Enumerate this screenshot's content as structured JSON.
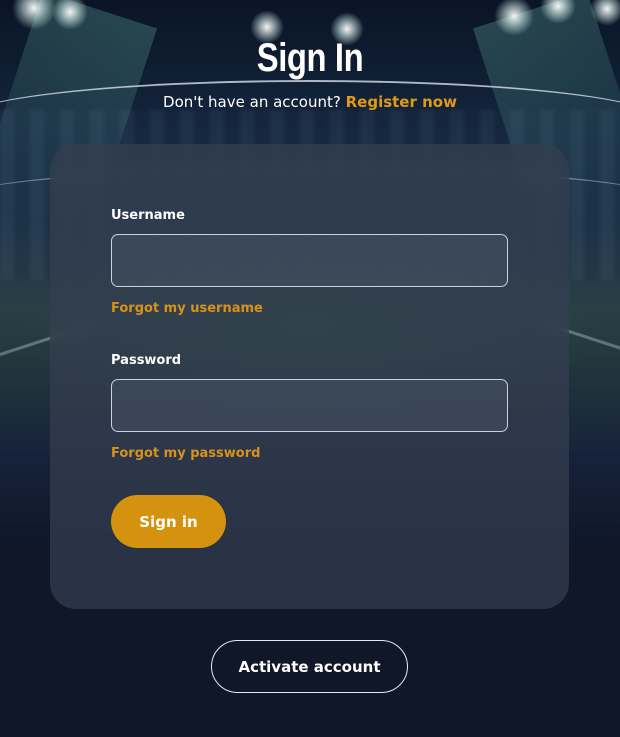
{
  "header": {
    "title": "Sign In",
    "register_prompt": "Don't have an account?",
    "register_link": "Register now"
  },
  "form": {
    "username": {
      "label": "Username",
      "value": "",
      "placeholder": "",
      "forgot_link": "Forgot my username"
    },
    "password": {
      "label": "Password",
      "value": "",
      "placeholder": "",
      "forgot_link": "Forgot my password"
    },
    "submit_label": "Sign in"
  },
  "footer": {
    "activate_label": "Activate account"
  },
  "colors": {
    "accent": "#d5920f",
    "background": "#0f1729",
    "card": "#343e50"
  }
}
